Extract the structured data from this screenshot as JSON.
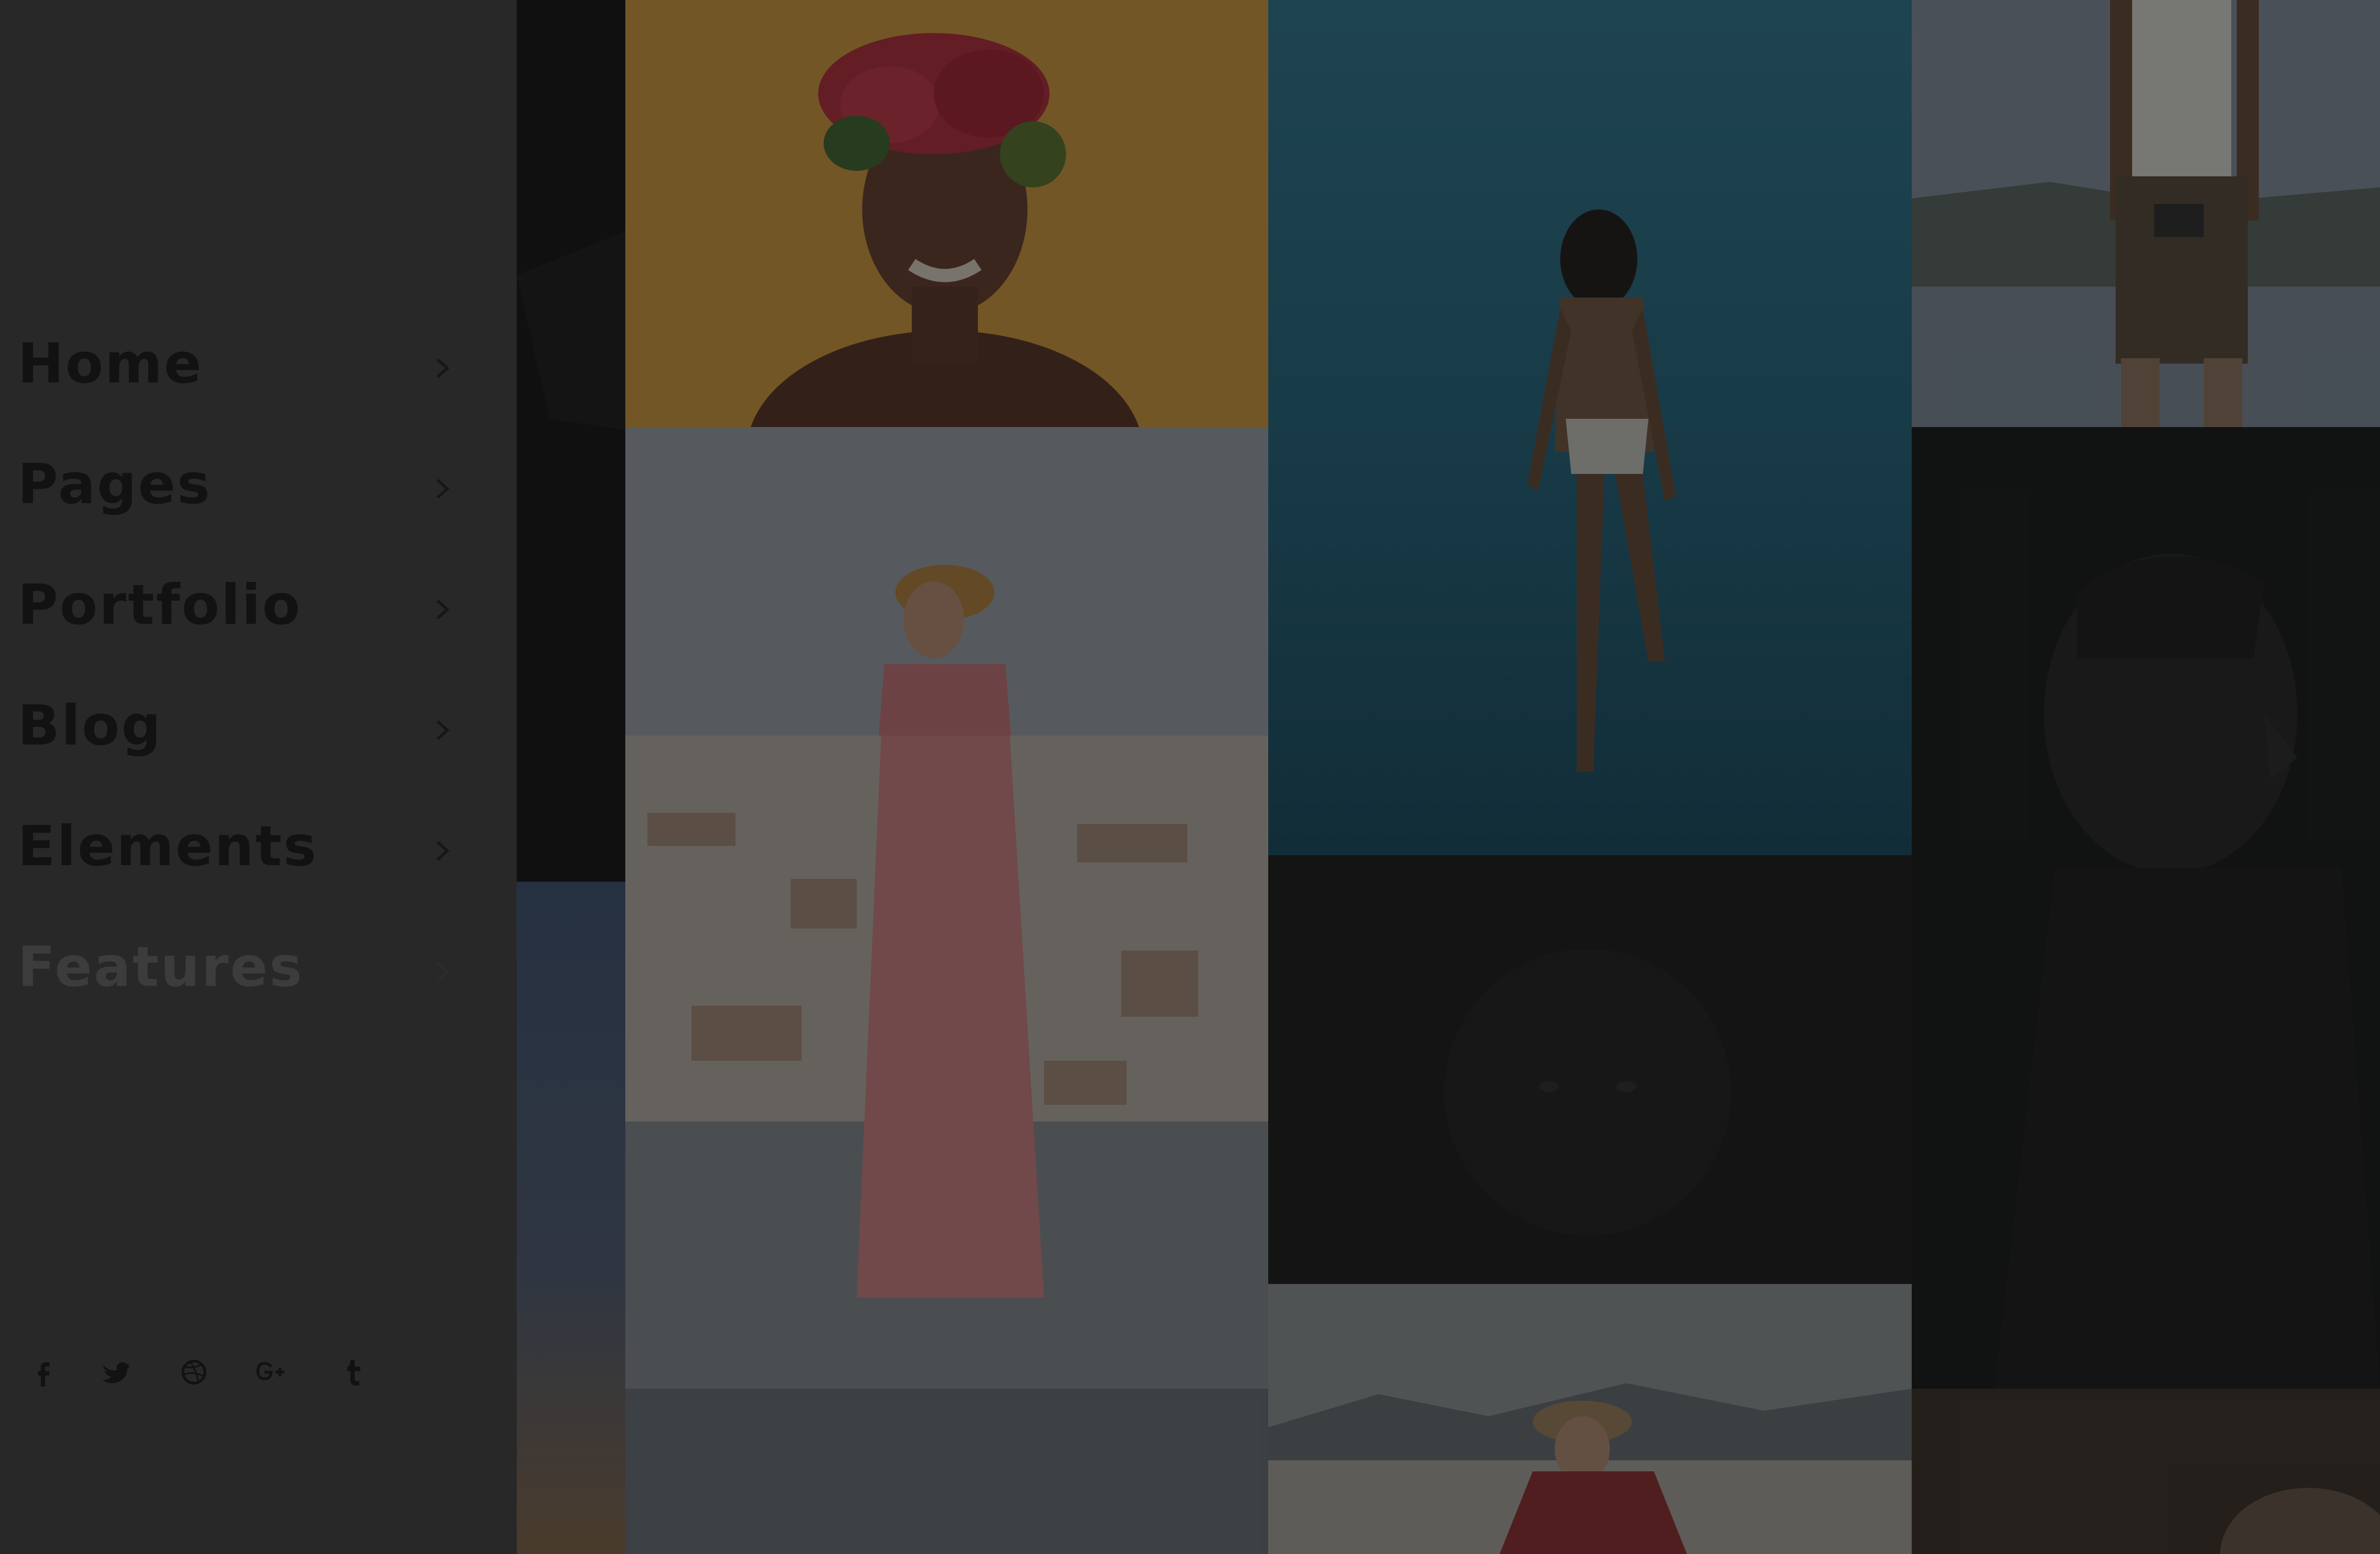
{
  "menu": {
    "items": [
      {
        "label": "Home"
      },
      {
        "label": "Pages"
      },
      {
        "label": "Portfolio"
      },
      {
        "label": "Blog"
      },
      {
        "label": "Elements"
      },
      {
        "label": "Features"
      }
    ]
  },
  "social": [
    "facebook-icon",
    "twitter-icon",
    "dribbble-icon",
    "google-plus-icon",
    "tumblr-icon"
  ],
  "colors": {
    "panel_bg": "#282828",
    "menu_text": "#121212",
    "menu_text_dim": "#3c3c3c",
    "overlay": "rgba(20,20,20,0.55)"
  }
}
